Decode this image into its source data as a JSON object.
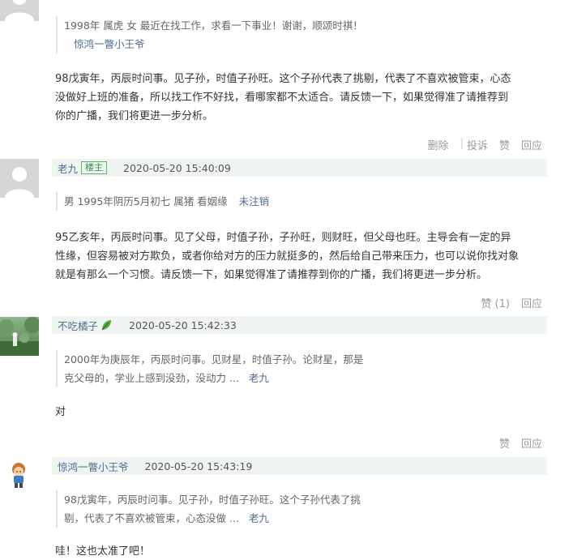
{
  "comment0": {
    "quote_text": "1998年 属虎 女 最近在找工作，求看一下事业！谢谢，顺颂时祺！",
    "quote_author": "惊鸿一瞥小王爷",
    "body_lines": [
      "98戊寅年，丙辰时问事。见子孙，时值子孙旺。这个子孙代表了挑剔，代表了不喜欢被管束，心态",
      "没做好上班的准备，所以找工作不好找，看哪家都不太适合。请反馈一下，如果觉得准了请推荐到",
      "你的广播，我们将更进一步分析。"
    ],
    "actions": {
      "delete": "删除",
      "sep": "|",
      "report": "投诉",
      "like": "赞",
      "reply": "回应"
    }
  },
  "comment1": {
    "username": "老九",
    "badge": "楼主",
    "timestamp": "2020-05-20 15:40:09",
    "quote_text": "男 1995年阴历5月初七 属猪 看姻缘",
    "quote_status": "未注销",
    "body_lines": [
      "95乙亥年，丙辰时问事。见了父母，时值子孙，子孙旺，则财旺，但父母也旺。主导会有一定的异",
      "性缘，但容易被对方欺负，或者你给对方的压力就挺多的，然后给自己带来压力，也可以说你找对象",
      "就是有那么一个习惯。请反馈一下，如果觉得准了请推荐到你的广播，我们将更进一步分析。"
    ],
    "actions": {
      "like": "赞 (1)",
      "reply": "回应"
    }
  },
  "comment2": {
    "username": "不吃橘子",
    "timestamp": "2020-05-20 15:42:33",
    "quote_lines": [
      "2000年为庚辰年，丙辰时问事。见财星，时值子孙。论财星，那是",
      "克父母的，学业上感到没劲，没动力 ..."
    ],
    "quote_author": "老九",
    "body": "对",
    "actions": {
      "like": "赞",
      "reply": "回应"
    }
  },
  "comment3": {
    "username": "惊鸿一瞥小王爷",
    "timestamp": "2020-05-20 15:43:19",
    "quote_lines": [
      "98戊寅年，丙辰时问事。见子孙，时值子孙旺。这个子孙代表了挑",
      "剔，代表了不喜欢被管束，心态没做 ..."
    ],
    "quote_author": "老九",
    "body": "哇！这也太准了吧！"
  }
}
